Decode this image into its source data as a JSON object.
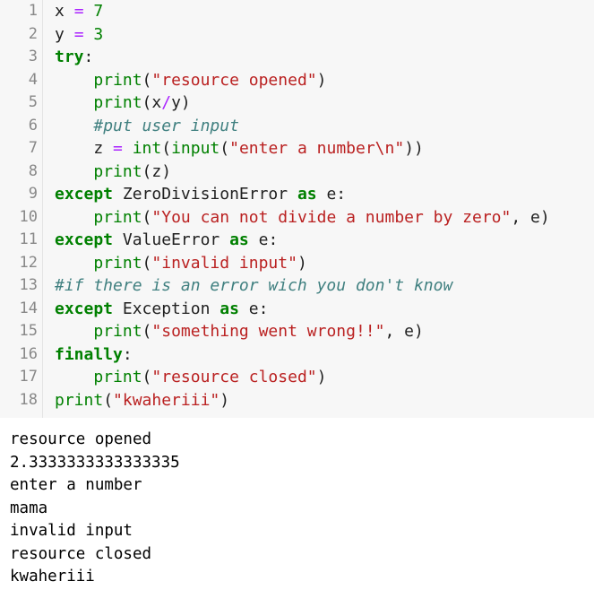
{
  "code_cell": {
    "lines": [
      {
        "number": "1",
        "tokens": [
          {
            "t": "x ",
            "c": "plain"
          },
          {
            "t": "=",
            "c": "op"
          },
          {
            "t": " ",
            "c": "plain"
          },
          {
            "t": "7",
            "c": "num"
          }
        ]
      },
      {
        "number": "2",
        "tokens": [
          {
            "t": "y ",
            "c": "plain"
          },
          {
            "t": "=",
            "c": "op"
          },
          {
            "t": " ",
            "c": "plain"
          },
          {
            "t": "3",
            "c": "num"
          }
        ]
      },
      {
        "number": "3",
        "tokens": [
          {
            "t": "try",
            "c": "kw"
          },
          {
            "t": ":",
            "c": "plain"
          }
        ]
      },
      {
        "number": "4",
        "tokens": [
          {
            "t": "    ",
            "c": "plain"
          },
          {
            "t": "print",
            "c": "bi"
          },
          {
            "t": "(",
            "c": "plain"
          },
          {
            "t": "\"resource opened\"",
            "c": "str"
          },
          {
            "t": ")",
            "c": "plain"
          }
        ]
      },
      {
        "number": "5",
        "tokens": [
          {
            "t": "    ",
            "c": "plain"
          },
          {
            "t": "print",
            "c": "bi"
          },
          {
            "t": "(x",
            "c": "plain"
          },
          {
            "t": "/",
            "c": "op"
          },
          {
            "t": "y)",
            "c": "plain"
          }
        ]
      },
      {
        "number": "6",
        "tokens": [
          {
            "t": "    ",
            "c": "plain"
          },
          {
            "t": "#put user input",
            "c": "cm"
          }
        ]
      },
      {
        "number": "7",
        "tokens": [
          {
            "t": "    z ",
            "c": "plain"
          },
          {
            "t": "=",
            "c": "op"
          },
          {
            "t": " ",
            "c": "plain"
          },
          {
            "t": "int",
            "c": "bi"
          },
          {
            "t": "(",
            "c": "plain"
          },
          {
            "t": "input",
            "c": "bi"
          },
          {
            "t": "(",
            "c": "plain"
          },
          {
            "t": "\"enter a number\\n\"",
            "c": "str"
          },
          {
            "t": "))",
            "c": "plain"
          }
        ]
      },
      {
        "number": "8",
        "tokens": [
          {
            "t": "    ",
            "c": "plain"
          },
          {
            "t": "print",
            "c": "bi"
          },
          {
            "t": "(z)",
            "c": "plain"
          }
        ]
      },
      {
        "number": "9",
        "tokens": [
          {
            "t": "except",
            "c": "kw"
          },
          {
            "t": " ZeroDivisionError ",
            "c": "plain"
          },
          {
            "t": "as",
            "c": "kw"
          },
          {
            "t": " e:",
            "c": "plain"
          }
        ]
      },
      {
        "number": "10",
        "tokens": [
          {
            "t": "    ",
            "c": "plain"
          },
          {
            "t": "print",
            "c": "bi"
          },
          {
            "t": "(",
            "c": "plain"
          },
          {
            "t": "\"You can not divide a number by zero\"",
            "c": "str"
          },
          {
            "t": ", e)",
            "c": "plain"
          }
        ]
      },
      {
        "number": "11",
        "tokens": [
          {
            "t": "except",
            "c": "kw"
          },
          {
            "t": " ValueError ",
            "c": "plain"
          },
          {
            "t": "as",
            "c": "kw"
          },
          {
            "t": " e:",
            "c": "plain"
          }
        ]
      },
      {
        "number": "12",
        "tokens": [
          {
            "t": "    ",
            "c": "plain"
          },
          {
            "t": "print",
            "c": "bi"
          },
          {
            "t": "(",
            "c": "plain"
          },
          {
            "t": "\"invalid input\"",
            "c": "str"
          },
          {
            "t": ")",
            "c": "plain"
          }
        ]
      },
      {
        "number": "13",
        "tokens": [
          {
            "t": "#if there is an error wich you don't know",
            "c": "cm"
          }
        ]
      },
      {
        "number": "14",
        "tokens": [
          {
            "t": "except",
            "c": "kw"
          },
          {
            "t": " Exception ",
            "c": "plain"
          },
          {
            "t": "as",
            "c": "kw"
          },
          {
            "t": " e:",
            "c": "plain"
          }
        ]
      },
      {
        "number": "15",
        "tokens": [
          {
            "t": "    ",
            "c": "plain"
          },
          {
            "t": "print",
            "c": "bi"
          },
          {
            "t": "(",
            "c": "plain"
          },
          {
            "t": "\"something went wrong!!\"",
            "c": "str"
          },
          {
            "t": ", e)",
            "c": "plain"
          }
        ]
      },
      {
        "number": "16",
        "tokens": [
          {
            "t": "finally",
            "c": "kw"
          },
          {
            "t": ":",
            "c": "plain"
          }
        ]
      },
      {
        "number": "17",
        "tokens": [
          {
            "t": "    ",
            "c": "plain"
          },
          {
            "t": "print",
            "c": "bi"
          },
          {
            "t": "(",
            "c": "plain"
          },
          {
            "t": "\"resource closed\"",
            "c": "str"
          },
          {
            "t": ")",
            "c": "plain"
          }
        ]
      },
      {
        "number": "18",
        "tokens": [
          {
            "t": "print",
            "c": "bi"
          },
          {
            "t": "(",
            "c": "plain"
          },
          {
            "t": "\"kwaheriii\"",
            "c": "str"
          },
          {
            "t": ")",
            "c": "plain"
          }
        ]
      }
    ]
  },
  "output": {
    "lines": [
      "resource opened",
      "2.3333333333333335",
      "enter a number",
      "mama",
      "invalid input",
      "resource closed",
      "kwaheriii"
    ]
  },
  "colors": {
    "keyword": "#008000",
    "builtin": "#008000",
    "string": "#ba2121",
    "operator": "#aa22ff",
    "number": "#008000",
    "comment": "#408080",
    "gutter_text": "#888888",
    "cell_background": "#f7f7f7"
  }
}
